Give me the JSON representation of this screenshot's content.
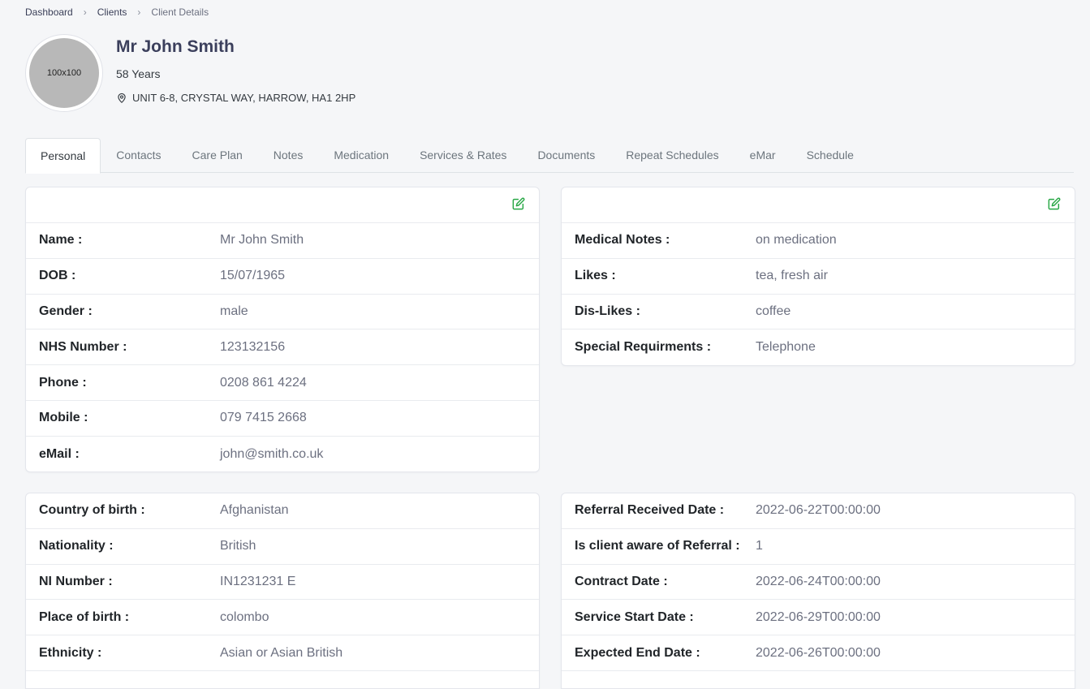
{
  "breadcrumb": {
    "dashboard": "Dashboard",
    "clients": "Clients",
    "current": "Client Details",
    "separator": "›"
  },
  "client": {
    "avatar_text": "100x100",
    "name": "Mr John Smith",
    "age": "58 Years",
    "address": "UNIT 6-8, CRYSTAL WAY, HARROW, HA1 2HP"
  },
  "tabs": [
    {
      "label": "Personal",
      "active": true
    },
    {
      "label": "Contacts"
    },
    {
      "label": "Care Plan"
    },
    {
      "label": "Notes"
    },
    {
      "label": "Medication"
    },
    {
      "label": "Services & Rates"
    },
    {
      "label": "Documents"
    },
    {
      "label": "Repeat Schedules"
    },
    {
      "label": "eMar"
    },
    {
      "label": "Schedule"
    }
  ],
  "personal_card": {
    "rows": [
      {
        "label": "Name :",
        "value": "Mr John Smith"
      },
      {
        "label": "DOB :",
        "value": "15/07/1965"
      },
      {
        "label": "Gender :",
        "value": "male"
      },
      {
        "label": "NHS Number :",
        "value": "123132156"
      },
      {
        "label": "Phone :",
        "value": "0208 861 4224"
      },
      {
        "label": "Mobile :",
        "value": "079 7415 2668"
      },
      {
        "label": "eMail :",
        "value": "john@smith.co.uk"
      }
    ]
  },
  "medical_card": {
    "rows": [
      {
        "label": "Medical Notes :",
        "value": "on medication"
      },
      {
        "label": "Likes :",
        "value": "tea, fresh air"
      },
      {
        "label": "Dis-Likes :",
        "value": "coffee"
      },
      {
        "label": "Special Requirments :",
        "value": "Telephone"
      }
    ]
  },
  "origin_card": {
    "rows": [
      {
        "label": "Country of birth :",
        "value": "Afghanistan"
      },
      {
        "label": "Nationality :",
        "value": "British"
      },
      {
        "label": "NI Number :",
        "value": "IN1231231 E"
      },
      {
        "label": "Place of birth :",
        "value": "colombo"
      },
      {
        "label": "Ethnicity :",
        "value": "Asian or Asian British"
      }
    ]
  },
  "referral_card": {
    "rows": [
      {
        "label": "Referral Received Date :",
        "value": "2022-06-22T00:00:00"
      },
      {
        "label": "Is client aware of Referral :",
        "value": "1"
      },
      {
        "label": "Contract Date :",
        "value": "2022-06-24T00:00:00"
      },
      {
        "label": "Service Start Date :",
        "value": "2022-06-29T00:00:00"
      },
      {
        "label": "Expected End Date :",
        "value": "2022-06-26T00:00:00"
      }
    ]
  },
  "colors": {
    "accent_green": "#28a745",
    "title": "#3b3f5c"
  }
}
